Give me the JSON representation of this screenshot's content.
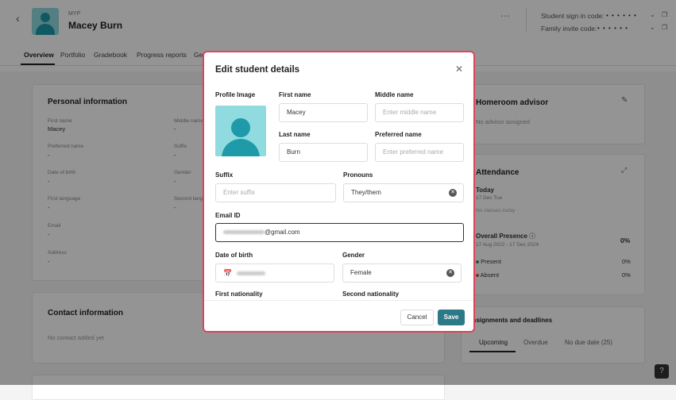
{
  "header": {
    "grade": "MYP",
    "student_name": "Macey Burn",
    "student_code_label": "Student sign in code:",
    "student_code": "• • • • • •",
    "family_code_label": "Family invite code:",
    "family_code": "• • • • • •"
  },
  "tabs": [
    "Overview",
    "Portfolio",
    "Gradebook",
    "Progress reports",
    "Ge"
  ],
  "personal": {
    "title": "Personal information",
    "fields": [
      {
        "label": "First name",
        "value": "Macey"
      },
      {
        "label": "Middle name",
        "value": "-"
      },
      {
        "label": "Preferred name",
        "value": "-"
      },
      {
        "label": "Suffix",
        "value": "-"
      },
      {
        "label": "Date of birth",
        "value": "-"
      },
      {
        "label": "Gender",
        "value": "-"
      },
      {
        "label": "First language",
        "value": "-"
      },
      {
        "label": "Second lang",
        "value": "-"
      },
      {
        "label": "Email",
        "value": "-"
      },
      {
        "label": "Address",
        "value": "-"
      }
    ]
  },
  "contact": {
    "title": "Contact information",
    "empty": "No contact added yet"
  },
  "homeroom": {
    "title": "Homeroom advisor",
    "empty": "No advisor assigned"
  },
  "attendance": {
    "title": "Attendance",
    "today_label": "Today",
    "today_date": "17 Dec Tue",
    "today_status": "No classes today",
    "overall_label": "Overall Presence",
    "overall_range": "17 Aug 2022 - 17 Dec 2024",
    "overall_value": "0%",
    "present_label": "Present",
    "present_value": "0%",
    "absent_label": "Absent",
    "absent_value": "0%",
    "present_color": "#2e9e5b",
    "absent_color": "#d9534f"
  },
  "assignments": {
    "title": "ssignments and deadlines",
    "tabs": [
      "Upcoming",
      "Overdue",
      "No due date (25)"
    ]
  },
  "modal": {
    "title": "Edit student details",
    "profile_label": "Profile Image",
    "first_name_label": "First name",
    "first_name": "Macey",
    "middle_name_label": "Middle name",
    "middle_name_placeholder": "Enter middle name",
    "last_name_label": "Last name",
    "last_name": "Burn",
    "preferred_name_label": "Preferred name",
    "preferred_name_placeholder": "Enter preferred name",
    "suffix_label": "Suffix",
    "suffix_placeholder": "Enter suffix",
    "pronouns_label": "Pronouns",
    "pronouns": "They/them",
    "email_label": "Email ID",
    "email_domain": "@gmail.com",
    "dob_label": "Date of birth",
    "gender_label": "Gender",
    "gender": "Female",
    "first_nationality_label": "First nationality",
    "second_nationality_label": "Second nationality",
    "cancel": "Cancel",
    "save": "Save"
  },
  "help": "?"
}
